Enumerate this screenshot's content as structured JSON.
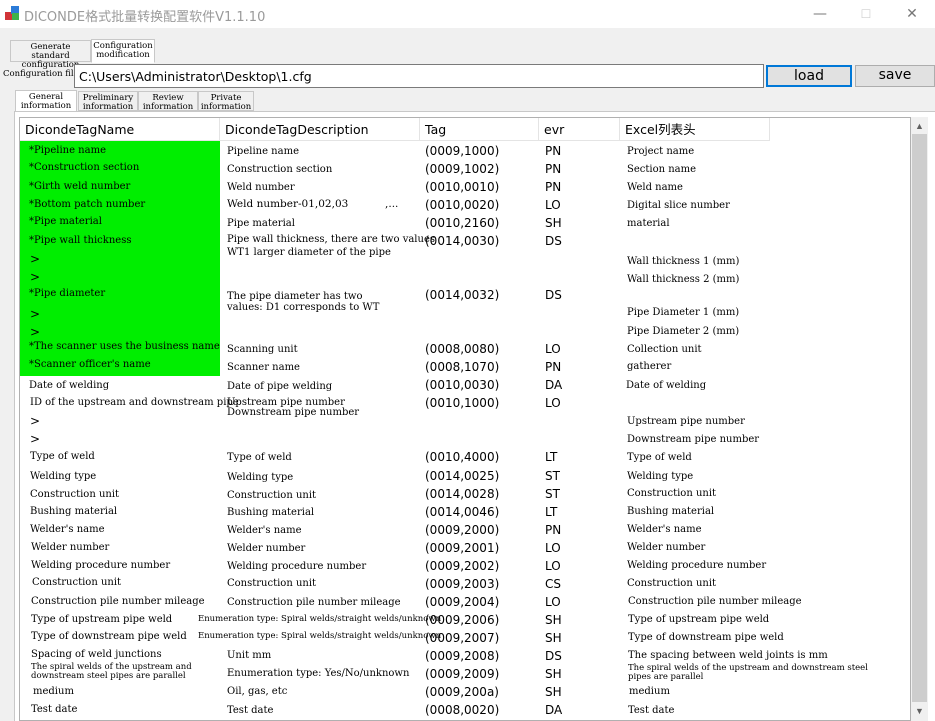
{
  "window": {
    "title": "DICONDE格式批量转换配置软件V1.1.10",
    "minimize_glyph": "—",
    "maximize_glyph": "☐",
    "close_glyph": "✕"
  },
  "top_tabs": [
    {
      "label": "Generate standard\nconfiguration",
      "active": false
    },
    {
      "label": "Configuration\nmodification",
      "active": true
    }
  ],
  "config": {
    "label": "Configuration file",
    "path": "C:\\Users\\Administrator\\Desktop\\1.cfg",
    "load_label": "load",
    "save_label": "save"
  },
  "sub_tabs": [
    {
      "label": "General\ninformation",
      "active": true
    },
    {
      "label": "Preliminary\ninformation",
      "active": false
    },
    {
      "label": "Review\ninformation",
      "active": false
    },
    {
      "label": "Private\ninformation",
      "active": false
    }
  ],
  "columns": [
    "DicondeTagName",
    "DicondeTagDescription",
    "Tag",
    "evr",
    "Excel列表头"
  ],
  "colors": {
    "highlight_green": "#00ee00",
    "accent_blue": "#0078d7"
  },
  "scroll_icons": {
    "up": "▲",
    "down": "▼"
  },
  "rows": {
    "name": [
      "*Pipeline name",
      "*Construction section",
      "*Girth weld number",
      "*Bottom patch number",
      "*Pipe material",
      "*Pipe wall thickness",
      ">",
      ">",
      "*Pipe diameter",
      ">",
      ">",
      "*The scanner uses the business name",
      "*Scanner officer's name",
      "Date of welding",
      "ID of the upstream and downstream pipe",
      ">",
      ">",
      "Type of weld",
      "Welding type",
      "Construction unit",
      "Bushing material",
      "Welder's name",
      "Welder number",
      "Welding procedure number",
      "Construction unit",
      "Construction pile number mileage",
      "Type of upstream pipe weld",
      "Type of downstream pipe weld",
      "Spacing of weld junctions",
      "The spiral welds of the upstream and\ndownstream steel pipes are parallel",
      "medium",
      "Test date"
    ],
    "desc": [
      "Pipeline name",
      "Construction section",
      "Weld number",
      "Weld number-01,02,03           ,...",
      "Pipe material",
      "Pipe wall thickness, there are two values\nWT1 larger diameter of the pipe",
      "The pipe diameter has two\nvalues: D1 corresponds to WT",
      "Scanning unit",
      "Scanner name",
      "Date of pipe welding",
      "Upstream pipe number\nDownstream pipe number",
      "Type of weld",
      "Welding type",
      "Construction unit",
      "Bushing material",
      "Welder's name",
      "Welder number",
      "Welding procedure number",
      "Construction unit",
      "Construction pile number mileage",
      "Enumeration type:  Spiral welds/straight welds/unknown",
      "Enumeration type:  Spiral welds/straight welds/unknown",
      "Unit mm",
      "Enumeration type: Yes/No/unknown",
      "Oil, gas, etc",
      "Test date"
    ],
    "tag": [
      "(0009,1000)",
      "(0009,1002)",
      "(0010,0010)",
      "(0010,0020)",
      "(0010,2160)",
      "(0014,0030)",
      "(0014,0032)",
      "(0008,0080)",
      "(0008,1070)",
      "(0010,0030)",
      "(0010,1000)",
      "(0010,4000)",
      "(0014,0025)",
      "(0014,0028)",
      "(0014,0046)",
      "(0009,2000)",
      "(0009,2001)",
      "(0009,2002)",
      "(0009,2003)",
      "(0009,2004)",
      "(0009,2006)",
      "(0009,2007)",
      "(0009,2008)",
      "(0009,2009)",
      "(0009,200a)",
      "(0008,0020)"
    ],
    "evr": [
      "PN",
      "PN",
      "PN",
      "LO",
      "SH",
      "DS",
      "DS",
      "LO",
      "PN",
      "DA",
      "LO",
      "LT",
      "ST",
      "ST",
      "LT",
      "PN",
      "LO",
      "LO",
      "CS",
      "LO",
      "SH",
      "SH",
      "DS",
      "SH",
      "SH",
      "DA"
    ],
    "excel": [
      "Project name",
      "Section name",
      "Weld name",
      "Digital slice number",
      "material",
      "Wall thickness 1 (mm)",
      "Wall thickness 2 (mm)",
      "Pipe Diameter 1 (mm)",
      "Pipe Diameter 2 (mm)",
      "Collection unit",
      "gatherer",
      "Date of welding",
      "Upstream pipe number",
      "Downstream pipe number",
      "Type of weld",
      "Welding type",
      "Construction unit",
      "Bushing material",
      "Welder's name",
      "Welder number",
      "Welding procedure number",
      "Construction unit",
      "Construction pile number mileage",
      "Type of upstream pipe weld",
      "Type of downstream pipe weld",
      "The spacing between weld joints is mm",
      "The spiral welds of the upstream and downstream steel\npipes are parallel",
      "medium",
      "Test date"
    ]
  }
}
